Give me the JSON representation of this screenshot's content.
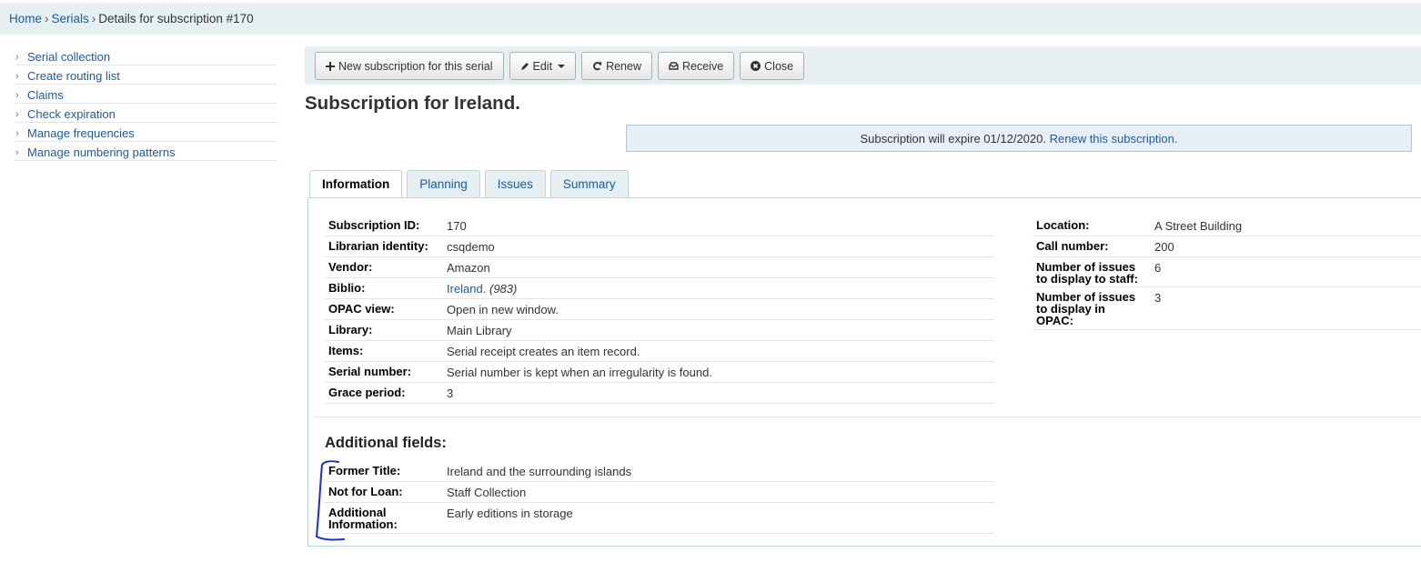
{
  "breadcrumb": {
    "home": "Home",
    "sep": "›",
    "serials": "Serials",
    "current": "Details for subscription #170"
  },
  "sidebar": {
    "bullet": "›",
    "items": [
      "Serial collection",
      "Create routing list",
      "Claims",
      "Check expiration",
      "Manage frequencies",
      "Manage numbering patterns"
    ]
  },
  "toolbar": {
    "new_label": "New subscription for this serial",
    "edit_label": "Edit",
    "renew_label": "Renew",
    "receive_label": "Receive",
    "close_label": "Close"
  },
  "page_title": "Subscription for Ireland.",
  "alert": {
    "text": "Subscription will expire 01/12/2020.",
    "link": "Renew this subscription."
  },
  "tabs": [
    "Information",
    "Planning",
    "Issues",
    "Summary"
  ],
  "info": {
    "subscription_id": {
      "label": "Subscription ID:",
      "value": "170"
    },
    "librarian": {
      "label": "Librarian identity:",
      "value": "csqdemo"
    },
    "vendor": {
      "label": "Vendor:",
      "value": "Amazon"
    },
    "biblio": {
      "label": "Biblio:",
      "value": "Ireland.",
      "extra": "(983)"
    },
    "opac": {
      "label": "OPAC view:",
      "value": "Open in new window."
    },
    "library": {
      "label": "Library:",
      "value": "Main Library"
    },
    "items": {
      "label": "Items:",
      "value": "Serial receipt creates an item record."
    },
    "serial_number": {
      "label": "Serial number:",
      "value": "Serial number is kept when an irregularity is found."
    },
    "grace": {
      "label": "Grace period:",
      "value": "3"
    }
  },
  "info_right": {
    "location": {
      "label": "Location:",
      "value": "A Street Building"
    },
    "callnumber": {
      "label": "Call number:",
      "value": "200"
    },
    "staff_issues": {
      "label1": "Number of issues",
      "label2": "to display to staff:",
      "value": "6"
    },
    "opac_issues": {
      "label1": "Number of issues",
      "label2": "to display in",
      "label3": "OPAC:",
      "value": "3"
    }
  },
  "additional": {
    "heading": "Additional fields:",
    "former_title": {
      "label": "Former Title:",
      "value": "Ireland and the surrounding islands"
    },
    "not_for_loan": {
      "label": "Not for Loan:",
      "value": "Staff Collection"
    },
    "additional_info": {
      "label1": "Additional",
      "label2": "Information:",
      "value": "Early editions in storage"
    }
  },
  "colors": {
    "link": "#1e5a96",
    "bg_band": "#e6f0f2",
    "annotation": "#1a2fc9"
  }
}
